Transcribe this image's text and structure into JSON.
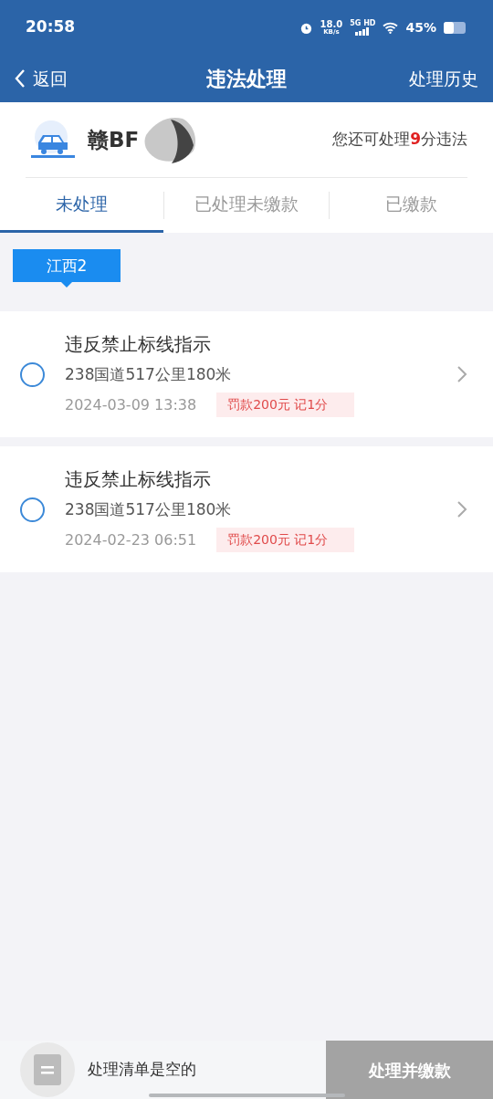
{
  "status_bar": {
    "time": "20:58",
    "net_speed": "18.0",
    "net_unit": "KB/s",
    "network": "5G HD",
    "battery": "45%"
  },
  "nav": {
    "back": "返回",
    "title": "违法处理",
    "action": "处理历史"
  },
  "vehicle": {
    "plate": "赣BF",
    "points_before": "您还可处理",
    "points_value": "9",
    "points_after": "分违法"
  },
  "tabs": [
    {
      "label": "未处理",
      "selected": true
    },
    {
      "label": "已处理未缴款",
      "selected": false
    },
    {
      "label": "已缴款",
      "selected": false
    }
  ],
  "region_tag": "江西2",
  "violations": [
    {
      "title": "违反禁止标线指示",
      "location": "238国道517公里180米",
      "time": "2024-03-09 13:38",
      "penalty": "罚款200元 记1分",
      "selected": false
    },
    {
      "title": "违反禁止标线指示",
      "location": "238国道517公里180米",
      "time": "2024-02-23 06:51",
      "penalty": "罚款200元 记1分",
      "selected": false
    }
  ],
  "bottom_bar": {
    "cart_text": "处理清单是空的",
    "button": "处理并缴款",
    "button_disabled": true
  }
}
